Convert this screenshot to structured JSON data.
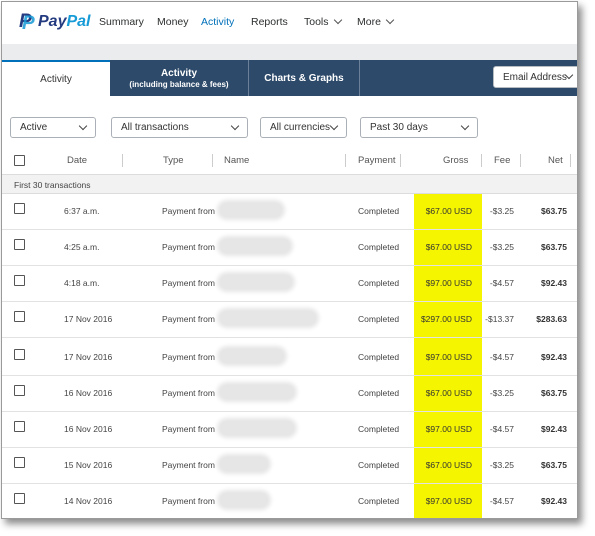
{
  "nav": {
    "brand_pay": "Pay",
    "brand_pal": "Pal",
    "items": [
      {
        "label": "Summary"
      },
      {
        "label": "Money"
      },
      {
        "label": "Activity"
      },
      {
        "label": "Reports"
      },
      {
        "label": "Tools"
      },
      {
        "label": "More"
      }
    ]
  },
  "tabs": [
    {
      "label": "Activity",
      "sub": ""
    },
    {
      "label": "Activity",
      "sub": "(including balance & fees)"
    },
    {
      "label": "Charts & Graphs",
      "sub": ""
    }
  ],
  "email_dropdown": "Email Address",
  "filters": {
    "status": "Active",
    "type": "All transactions",
    "currency": "All currencies",
    "period": "Past 30 days"
  },
  "table": {
    "headers": {
      "date": "Date",
      "type": "Type",
      "name": "Name",
      "payment": "Payment",
      "gross": "Gross",
      "fee": "Fee",
      "net": "Net"
    },
    "group_label": "First 30 transactions",
    "rows": [
      {
        "date": "6:37 a.m.",
        "type": "Payment from",
        "payment": "Completed",
        "gross": "$67.00 USD",
        "fee": "-$3.25",
        "net": "$63.75"
      },
      {
        "date": "4:25 a.m.",
        "type": "Payment from",
        "payment": "Completed",
        "gross": "$67.00 USD",
        "fee": "-$3.25",
        "net": "$63.75"
      },
      {
        "date": "4:18 a.m.",
        "type": "Payment from",
        "payment": "Completed",
        "gross": "$97.00 USD",
        "fee": "-$4.57",
        "net": "$92.43"
      },
      {
        "date": "17 Nov 2016",
        "type": "Payment from",
        "payment": "Completed",
        "gross": "$297.00 USD",
        "fee": "-$13.37",
        "net": "$283.63"
      },
      {
        "date": "17 Nov 2016",
        "type": "Payment from",
        "payment": "Completed",
        "gross": "$97.00 USD",
        "fee": "-$4.57",
        "net": "$92.43"
      },
      {
        "date": "16 Nov 2016",
        "type": "Payment from",
        "payment": "Completed",
        "gross": "$67.00 USD",
        "fee": "-$3.25",
        "net": "$63.75"
      },
      {
        "date": "16 Nov 2016",
        "type": "Payment from",
        "payment": "Completed",
        "gross": "$97.00 USD",
        "fee": "-$4.57",
        "net": "$92.43"
      },
      {
        "date": "15 Nov 2016",
        "type": "Payment from",
        "payment": "Completed",
        "gross": "$67.00 USD",
        "fee": "-$3.25",
        "net": "$63.75"
      },
      {
        "date": "14 Nov 2016",
        "type": "Payment from",
        "payment": "Completed",
        "gross": "$97.00 USD",
        "fee": "-$4.57",
        "net": "$92.43"
      }
    ]
  },
  "colors": {
    "brand_dark": "#253b80",
    "brand_light": "#179bd7",
    "active_nav": "#0070ba",
    "tab_bar": "#2d4a6a",
    "gross_highlight": "#f5f500"
  }
}
